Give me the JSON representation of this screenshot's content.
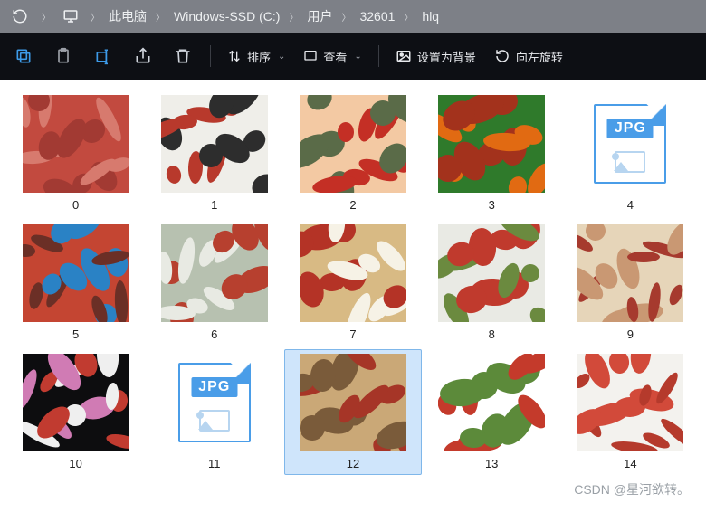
{
  "breadcrumb": {
    "items": [
      "此电脑",
      "Windows-SSD (C:)",
      "用户",
      "32601",
      "hlq"
    ]
  },
  "toolbar": {
    "sort": "排序",
    "view": "查看",
    "set_bg": "设置为背景",
    "rotate_left": "向左旋转"
  },
  "files": [
    {
      "name": "0",
      "type": "photo",
      "colors": [
        "#c24a3f",
        "#d77a6e",
        "#a23a33"
      ]
    },
    {
      "name": "1",
      "type": "photo",
      "colors": [
        "#efeee9",
        "#b8392c",
        "#2d2d2d"
      ]
    },
    {
      "name": "2",
      "type": "photo",
      "colors": [
        "#f3c9a3",
        "#c42f25",
        "#5a6b48"
      ]
    },
    {
      "name": "3",
      "type": "photo",
      "colors": [
        "#2f7a2b",
        "#e16a12",
        "#a3321c"
      ]
    },
    {
      "name": "4",
      "type": "jpg_icon"
    },
    {
      "name": "5",
      "type": "photo",
      "colors": [
        "#c44532",
        "#2a82c5",
        "#6b2f26"
      ]
    },
    {
      "name": "6",
      "type": "photo",
      "colors": [
        "#b7c1b0",
        "#b7402f",
        "#e8eae3"
      ]
    },
    {
      "name": "7",
      "type": "photo",
      "colors": [
        "#d8ba84",
        "#b43326",
        "#f6f2e6"
      ]
    },
    {
      "name": "8",
      "type": "photo",
      "colors": [
        "#e9eae4",
        "#c03a2d",
        "#6b8a3f"
      ]
    },
    {
      "name": "9",
      "type": "photo",
      "colors": [
        "#e6d5b9",
        "#a63a2e",
        "#c99873"
      ]
    },
    {
      "name": "10",
      "type": "photo",
      "colors": [
        "#0d0d0f",
        "#efefef",
        "#c13b30",
        "#d07bb4"
      ]
    },
    {
      "name": "11",
      "type": "jpg_icon"
    },
    {
      "name": "12",
      "type": "photo",
      "colors": [
        "#caa877",
        "#a63527",
        "#7a5b3a"
      ],
      "selected": true
    },
    {
      "name": "13",
      "type": "photo",
      "colors": [
        "#ffffff",
        "#c43a2b",
        "#5c8a3a"
      ]
    },
    {
      "name": "14",
      "type": "photo",
      "colors": [
        "#f3f2ee",
        "#d24a3a",
        "#b53a2c"
      ]
    }
  ],
  "icon_label": "JPG",
  "watermark": "CSDN @星河欲转。"
}
